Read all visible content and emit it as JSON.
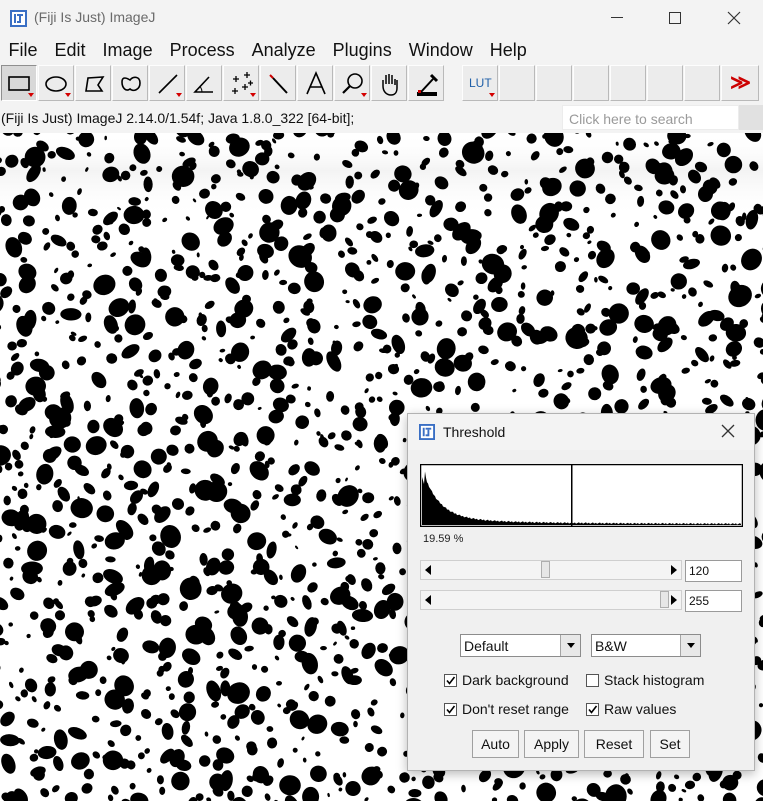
{
  "window": {
    "title": "(Fiji Is Just) ImageJ"
  },
  "menu": [
    "File",
    "Edit",
    "Image",
    "Process",
    "Analyze",
    "Plugins",
    "Window",
    "Help"
  ],
  "toolbar": {
    "tools": [
      "rectangle-tool",
      "oval-tool",
      "polygon-tool",
      "freehand-tool",
      "line-tool",
      "angle-tool",
      "multipoint-tool",
      "wand-tool",
      "text-tool",
      "magnifier-tool",
      "hand-tool",
      "color-picker-tool"
    ],
    "lut_label": "LUT",
    "more_label": "≫"
  },
  "status": {
    "text": "(Fiji Is Just) ImageJ 2.14.0/1.54f; Java 1.8.0_322 [64-bit];"
  },
  "search": {
    "placeholder": "Click here to search"
  },
  "threshold": {
    "title": "Threshold",
    "percentage": "19.59 %",
    "min_value": "120",
    "max_value": "255",
    "min_slider_fraction": 0.47,
    "max_slider_fraction": 1.0,
    "method": "Default",
    "display": "B&W",
    "dark_background": {
      "label": "Dark background",
      "checked": true
    },
    "stack_histogram": {
      "label": "Stack histogram",
      "checked": false
    },
    "dont_reset_range": {
      "label": "Don't reset range",
      "checked": true
    },
    "raw_values": {
      "label": "Raw values",
      "checked": true
    },
    "buttons": {
      "auto": "Auto",
      "apply": "Apply",
      "reset": "Reset",
      "set": "Set"
    }
  },
  "colors": {
    "chrome": "#f3f3f3",
    "particle": "#000000",
    "background": "#ffffff",
    "drop_arrow": "#d40000",
    "more_arrow": "#cc0000"
  }
}
